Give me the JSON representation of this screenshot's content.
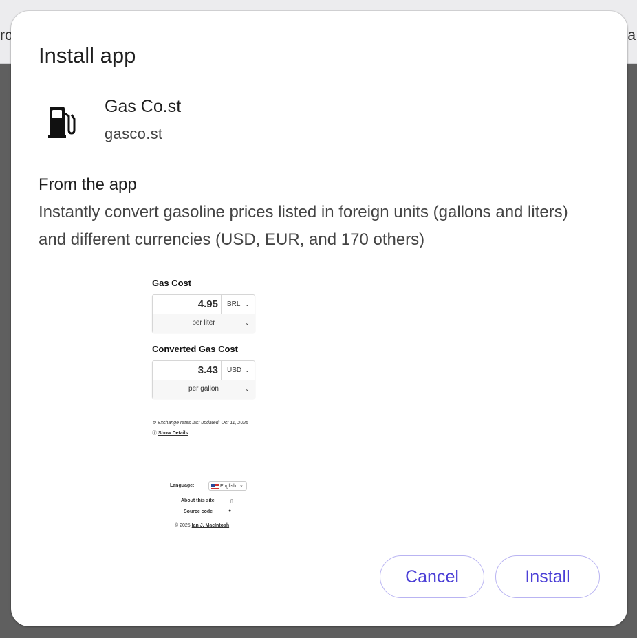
{
  "background": {
    "left_fragment": "ro",
    "right_fragment": "a"
  },
  "dialog": {
    "title": "Install app",
    "app_name": "Gas Co.st",
    "app_domain": "gasco.st",
    "icon": "gas-pump-icon",
    "from_label": "From the app",
    "description": "Instantly convert gasoline prices listed in foreign units (gallons and liters) and different currencies (USD, EUR, and 170 others)",
    "buttons": {
      "cancel": "Cancel",
      "install": "Install"
    },
    "accent_color": "#4b3fd6"
  },
  "screenshot": {
    "gas_cost_title": "Gas Cost",
    "gas_cost_value": "4.95",
    "gas_cost_currency": "BRL",
    "gas_cost_unit": "per liter",
    "converted_title": "Converted Gas Cost",
    "converted_value": "3.43",
    "converted_currency": "USD",
    "converted_unit": "per gallon",
    "exchange_note": "Exchange rates last updated: Oct 11, 2025",
    "show_details": "Show Details",
    "language_label": "Language:",
    "language_value": "English",
    "about": "About this site",
    "source": "Source code",
    "copyright_prefix": "© 2025",
    "author": "Ian J. MacIntosh"
  }
}
